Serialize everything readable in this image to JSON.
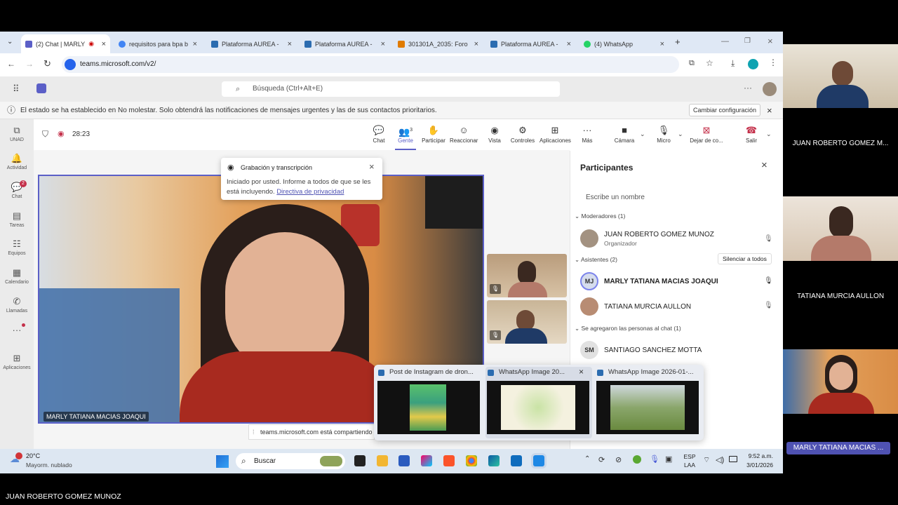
{
  "browser": {
    "tabs": [
      {
        "label": "(2) Chat | MARLY",
        "active": true
      },
      {
        "label": "requisitos para bpa b"
      },
      {
        "label": "Plataforma AUREA - "
      },
      {
        "label": "Plataforma AUREA - "
      },
      {
        "label": "301301A_2035: Foro"
      },
      {
        "label": "Plataforma AUREA - "
      },
      {
        "label": "(4) WhatsApp"
      }
    ],
    "new_tab": "+",
    "url": "teams.microsoft.com/v2/"
  },
  "teams": {
    "search_placeholder": "Búsqueda (Ctrl+Alt+E)",
    "banner_text": "El estado se ha establecido en No molestar. Solo obtendrá las notificaciones de mensajes urgentes y las de sus contactos prioritarios.",
    "banner_button": "Cambiar configuración",
    "rail": [
      {
        "label": "UNAD",
        "icon": "⧉"
      },
      {
        "label": "Actividad",
        "icon": "🔔"
      },
      {
        "label": "Chat",
        "icon": "💬",
        "badge": "2"
      },
      {
        "label": "Tareas",
        "icon": "▤"
      },
      {
        "label": "Equipos",
        "icon": "☷"
      },
      {
        "label": "Calendario",
        "icon": "▦"
      },
      {
        "label": "Llamadas",
        "icon": "✆"
      },
      {
        "label": "",
        "icon": "···"
      },
      {
        "label": "Aplicaciones",
        "icon": "⊞"
      }
    ],
    "meeting_timer": "28:23",
    "toolbar": [
      {
        "label": "Chat",
        "icon": "💬"
      },
      {
        "label": "Gente",
        "icon": "👥",
        "count": "3"
      },
      {
        "label": "Participar",
        "icon": "✋"
      },
      {
        "label": "Reaccionar",
        "icon": "☺"
      },
      {
        "label": "Vista",
        "icon": "◉"
      },
      {
        "label": "Controles",
        "icon": "⚙"
      },
      {
        "label": "Aplicaciones",
        "icon": "⊞"
      },
      {
        "label": "Más",
        "icon": "···"
      },
      {
        "label": "Cámara",
        "icon": "■"
      },
      {
        "label": "Micro",
        "icon": "🎙"
      },
      {
        "label": "Dejar de co...",
        "icon": "⊠"
      },
      {
        "label": "Salir",
        "icon": "☎"
      }
    ],
    "recording_popup": {
      "title": "Grabación y transcripción",
      "body": "Iniciado por usted. Informe a todos de que se les está incluyendo.",
      "link": "Directiva de privacidad"
    },
    "main_video_name": "MARLY TATIANA MACIAS JOAQUI",
    "sharing_notice": "teams.microsoft.com está compartiendo la",
    "participants": {
      "title": "Participantes",
      "search_placeholder": "Escribe un nombre",
      "moderators_header": "Moderadores (1)",
      "moderators": [
        {
          "name": "JUAN ROBERTO GOMEZ MUNOZ",
          "role": "Organizador"
        }
      ],
      "attendees_header": "Asistentes (2)",
      "mute_all": "Silenciar a todos",
      "attendees": [
        {
          "initials": "MJ",
          "name": "MARLY TATIANA MACIAS JOAQUI"
        },
        {
          "initials": "",
          "name": "TATIANA MURCIA AULLON"
        }
      ],
      "chat_header": "Se agregaron las personas al chat (1)",
      "chat_people": [
        {
          "initials": "SM",
          "name": "SANTIAGO SANCHEZ MOTTA"
        }
      ]
    }
  },
  "taskbar": {
    "weather_temp": "20°C",
    "weather_desc": "Mayorm. nublado",
    "search": "Buscar",
    "lang_1": "ESP",
    "lang_2": "LAA",
    "time": "9:52 a.m.",
    "date": "3/01/2026",
    "thumbnails": [
      {
        "title": "Post de Instagram de dron..."
      },
      {
        "title": "WhatsApp Image 20..."
      },
      {
        "title": "WhatsApp Image 2026-01-..."
      }
    ]
  },
  "side_videos": [
    {
      "name": "JUAN ROBERTO GOMEZ M..."
    },
    {
      "name": "TATIANA MURCIA AULLON"
    },
    {
      "name": "MARLY TATIANA MACIAS ..."
    }
  ],
  "bottom_caption": "JUAN ROBERTO GOMEZ MUNOZ"
}
